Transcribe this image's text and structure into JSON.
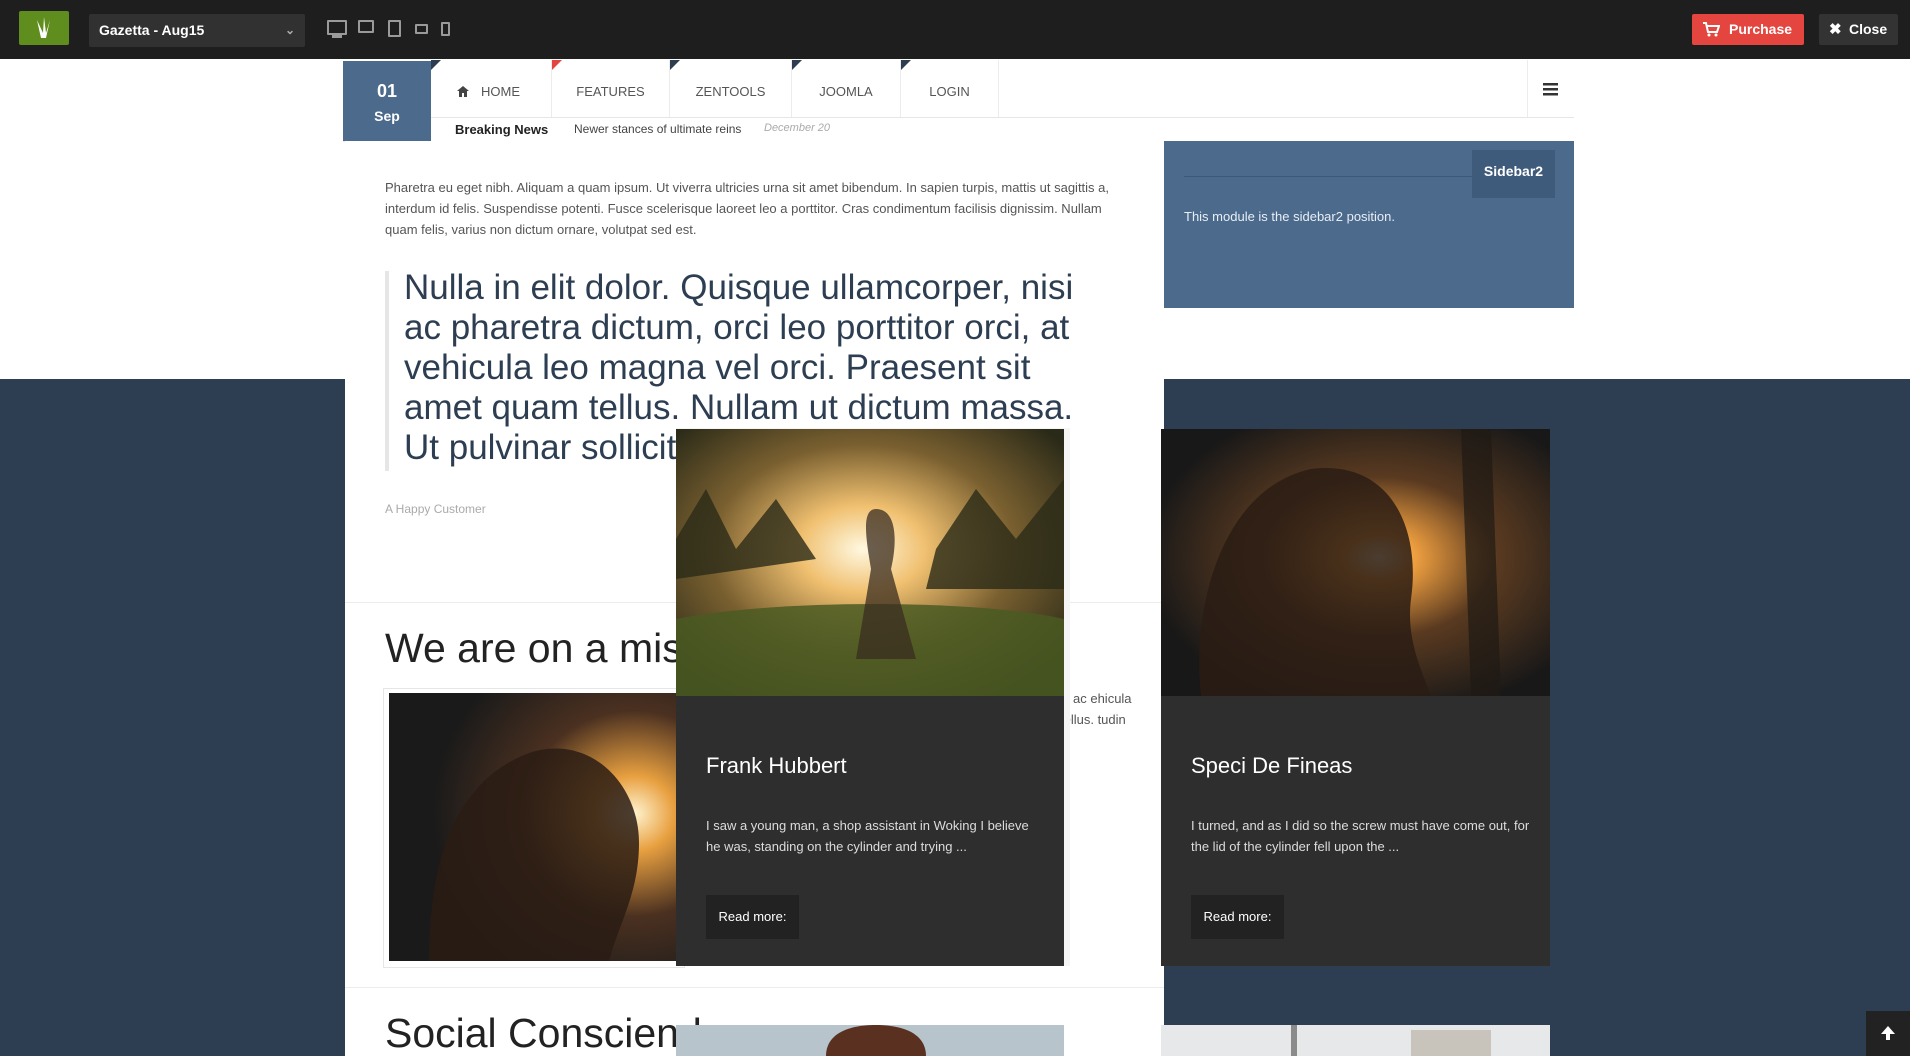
{
  "topbar": {
    "theme_name": "Gazetta - Aug15",
    "purchase_label": "Purchase",
    "close_label": "Close",
    "devices": [
      "desktop-icon",
      "tablet-landscape-icon",
      "tablet-portrait-icon",
      "phone-landscape-icon",
      "phone-portrait-icon"
    ]
  },
  "header": {
    "date_day": "01",
    "date_month": "Sep",
    "nav": [
      "HOME",
      "FEATURES",
      "ZENTOOLS",
      "JOOMLA",
      "LOGIN"
    ],
    "breaking_label": "Breaking News",
    "breaking_headline": "Newer stances of ultimate reins",
    "breaking_date": "December 20"
  },
  "main": {
    "intro": "Pharetra eu eget nibh. Aliquam a quam ipsum. Ut viverra ultricies urna sit amet bibendum. In sapien turpis, mattis ut sagittis a, interdum id felis. Suspendisse potenti. Fusce scelerisque laoreet leo a porttitor. Cras condimentum facilisis dignissim. Nullam quam felis, varius non dictum ornare, volutpat sed est.",
    "quote": "Nulla in elit dolor. Quisque ullamcorper, nisi ac pharetra dictum, orci leo porttitor orci, at vehicula leo magna vel orci. Praesent sit amet quam tellus. Nullam ut dictum massa. Ut pulvinar sollicitudin",
    "quote_author": "A Happy Customer",
    "mission_title": "We are on a miss",
    "mission_text": "si ac ehicula tellus. tudin",
    "social_title": "Social Consciend"
  },
  "sidebar2": {
    "title": "Sidebar2",
    "text": "This module is the sidebar2 position."
  },
  "cards": [
    {
      "name": "Frank Hubbert",
      "text": "I saw a young man, a shop assistant in Woking I believe he was, standing on the cylinder and trying ...",
      "button": "Read more:"
    },
    {
      "name": "Speci De Fineas",
      "text": "I turned, and as I did so the screw must have come out, for the lid of the cylinder fell upon the ...",
      "button": "Read more:"
    }
  ],
  "colors": {
    "accent": "#e4463f",
    "navy": "#2d3e52",
    "sidebar": "#4b6a8c",
    "logo_green": "#5f8d1e"
  }
}
